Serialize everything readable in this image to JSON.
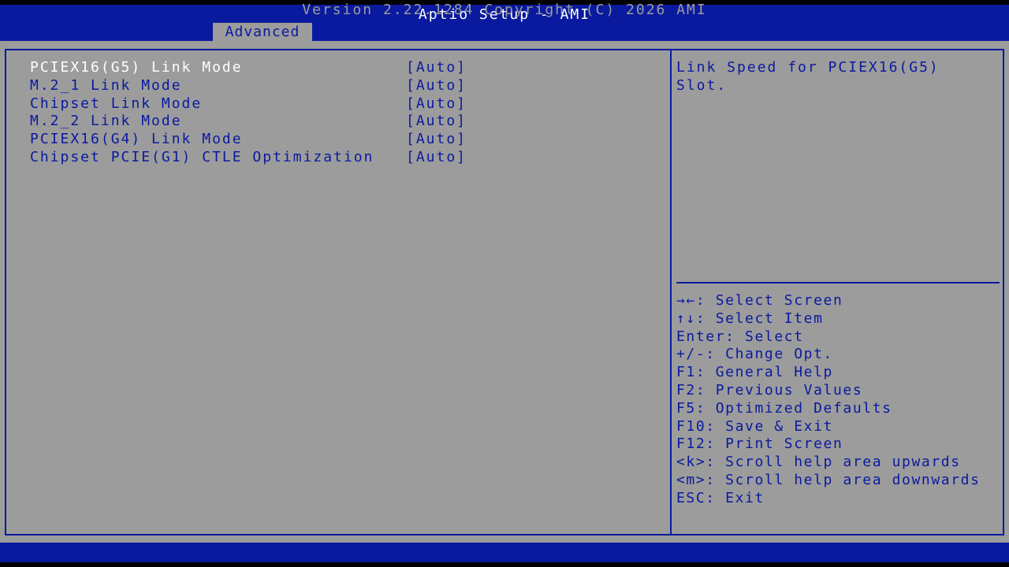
{
  "header": {
    "title": "Aptio Setup - AMI",
    "tab_label": "Advanced"
  },
  "settings": [
    {
      "label": "PCIEX16(G5) Link Mode",
      "value": "[Auto]"
    },
    {
      "label": "M.2_1 Link Mode",
      "value": "[Auto]"
    },
    {
      "label": "Chipset Link Mode",
      "value": "[Auto]"
    },
    {
      "label": "M.2_2 Link Mode",
      "value": "[Auto]"
    },
    {
      "label": "PCIEX16(G4) Link Mode",
      "value": "[Auto]"
    },
    {
      "label": "Chipset PCIE(G1) CTLE Optimization",
      "value": "[Auto]"
    }
  ],
  "help": {
    "line1": "Link Speed for PCIEX16(G5)",
    "line2": "Slot."
  },
  "keys": [
    "→←: Select Screen",
    "↑↓: Select Item",
    "Enter: Select",
    "+/-: Change Opt.",
    "F1: General Help",
    "F2: Previous Values",
    "F5: Optimized Defaults",
    "F10: Save & Exit",
    "F12: Print Screen",
    "<k>: Scroll help area upwards",
    "<m>: Scroll help area downwards",
    "ESC: Exit"
  ],
  "footer": {
    "version": "Version 2.22.1284 Copyright (C) 2026 AMI"
  },
  "colors": {
    "background": "#9c9c9c",
    "accent": "#0a1a9e",
    "highlight": "#ffffff"
  }
}
